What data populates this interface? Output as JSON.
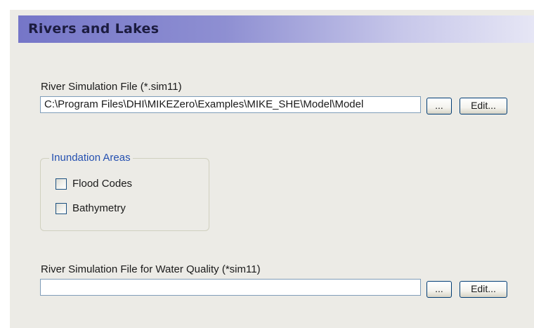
{
  "header": {
    "title": "Rivers and Lakes"
  },
  "river_sim": {
    "label": "River Simulation File (*.sim11)",
    "value": "C:\\Program Files\\DHI\\MIKEZero\\Examples\\MIKE_SHE\\Model\\Model",
    "browse_label": "...",
    "edit_label": "Edit..."
  },
  "inundation": {
    "legend": "Inundation Areas",
    "items": [
      {
        "label": "Flood Codes",
        "checked": false
      },
      {
        "label": "Bathymetry",
        "checked": false
      }
    ]
  },
  "water_quality": {
    "label": "River Simulation File for Water Quality (*sim11)",
    "value": "",
    "browse_label": "...",
    "edit_label": "Edit..."
  }
}
